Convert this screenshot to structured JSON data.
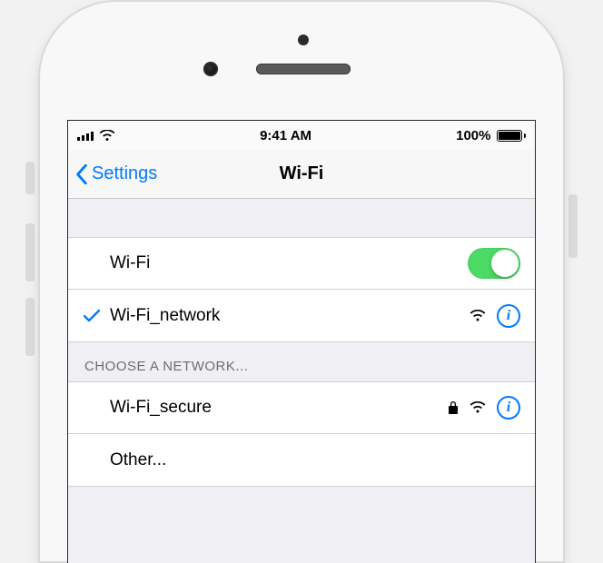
{
  "status": {
    "time": "9:41 AM",
    "battery_text": "100%"
  },
  "nav": {
    "back_label": "Settings",
    "title": "Wi-Fi"
  },
  "wifi_toggle": {
    "label": "Wi-Fi",
    "on": true
  },
  "connected": {
    "name": "Wi-Fi_network"
  },
  "choose_header": "CHOOSE A NETWORK...",
  "networks": [
    {
      "name": "Wi-Fi_secure",
      "secure": true
    }
  ],
  "other_label": "Other...",
  "colors": {
    "tint": "#007aff",
    "toggle_on": "#4cd964"
  }
}
